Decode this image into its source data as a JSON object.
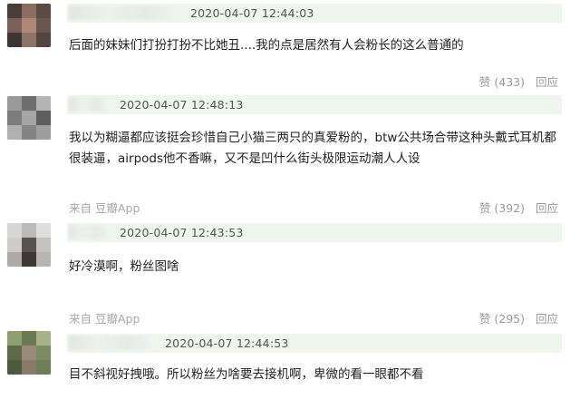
{
  "comments": [
    {
      "timestamp": "2020-04-07 12:44:03",
      "text": "后面的妹妹们打扮打扮不比她丑....我的点是居然有人会粉长的这么普通的",
      "source": "",
      "like_label": "赞 (433)",
      "reply_label": "回应"
    },
    {
      "timestamp": "2020-04-07 12:48:13",
      "text": "我以为糊逼都应该挺会珍惜自己小猫三两只的真爱粉的，btw公共场合带这种头戴式耳机都很装逼，airpods他不香嘛，又不是凹什么街头极限运动潮人人设",
      "source": "来自 豆瓣App",
      "like_label": "赞 (392)",
      "reply_label": "回应"
    },
    {
      "timestamp": "2020-04-07 12:43:53",
      "text": "好冷漠啊，粉丝图啥",
      "source": "来自 豆瓣App",
      "like_label": "赞 (295)",
      "reply_label": "回应"
    },
    {
      "timestamp": "2020-04-07 12:44:53",
      "text": "目不斜视好拽哦。所以粉丝为啥要去接机啊，卑微的看一眼都不看",
      "source": "",
      "like_label": "",
      "reply_label": ""
    }
  ]
}
